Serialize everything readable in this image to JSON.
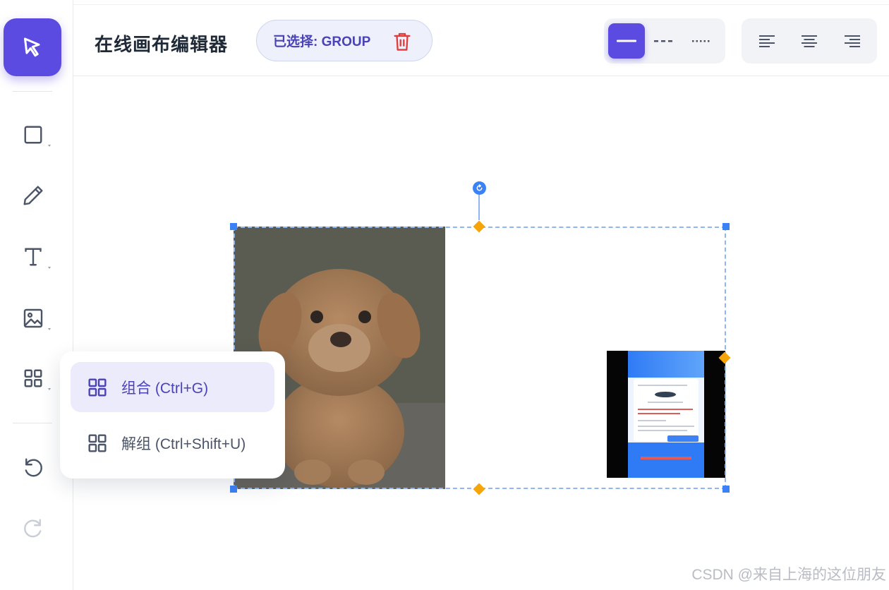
{
  "header": {
    "title": "在线画布编辑器",
    "selection_label": "已选择: GROUP"
  },
  "toolbar": {
    "tools": [
      {
        "name": "select",
        "icon": "cursor-arrow-icon",
        "active": true
      },
      {
        "name": "shape",
        "icon": "square-icon",
        "has_submenu": true
      },
      {
        "name": "pen",
        "icon": "pencil-icon"
      },
      {
        "name": "text",
        "icon": "text-icon",
        "has_submenu": true
      },
      {
        "name": "image",
        "icon": "image-icon",
        "has_submenu": true
      },
      {
        "name": "group",
        "icon": "grid-icon",
        "has_submenu": true
      },
      {
        "name": "undo",
        "icon": "undo-icon"
      },
      {
        "name": "redo",
        "icon": "redo-icon",
        "disabled": true
      }
    ]
  },
  "line_style": {
    "options": [
      "solid",
      "dashed",
      "dotted"
    ],
    "selected": "solid"
  },
  "text_align": {
    "options": [
      "left",
      "center",
      "right"
    ]
  },
  "group_menu": {
    "items": [
      {
        "label": "组合 (Ctrl+G)",
        "highlighted": true
      },
      {
        "label": "解组 (Ctrl+Shift+U)"
      }
    ]
  },
  "watermark": "CSDN @来自上海的这位朋友",
  "colors": {
    "accent": "#5b4be0",
    "selection": "#3b82f6",
    "handle_mid": "#f5a50a",
    "danger": "#e23b3b"
  }
}
